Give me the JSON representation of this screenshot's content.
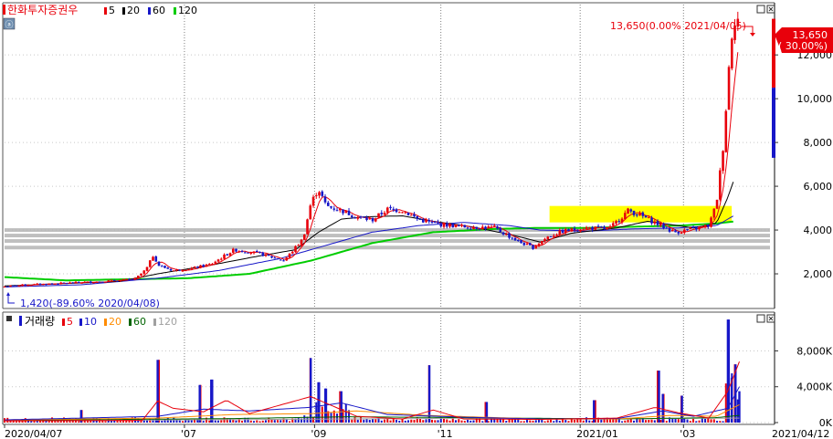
{
  "colors": {
    "up": "#e8000b",
    "down": "#1717c8",
    "ma5": "#e8000b",
    "ma20": "#000000",
    "ma60": "#1717c8",
    "ma120": "#00cc00",
    "highlight": "#ffff00",
    "hline": "#b4b4b4",
    "vol_ma10": "#1717c8",
    "vol_ma20": "#ff8c00",
    "vol_ma60": "#006400",
    "vol_ma120": "#a0a0a0",
    "grid": "#7f7f7f"
  },
  "price_legend": {
    "title": "한화투자증권우",
    "ma": [
      {
        "label": "5",
        "color": "#e8000b"
      },
      {
        "label": "20",
        "color": "#000000"
      },
      {
        "label": "60",
        "color": "#1717c8"
      },
      {
        "label": "120",
        "color": "#00cc00"
      }
    ]
  },
  "volume_legend": {
    "title": "거래량",
    "ma": [
      {
        "label": "5",
        "color": "#e8000b"
      },
      {
        "label": "10",
        "color": "#1717c8"
      },
      {
        "label": "20",
        "color": "#ff8c00"
      },
      {
        "label": "60",
        "color": "#006400"
      },
      {
        "label": "120",
        "color": "#a0a0a0"
      }
    ]
  },
  "annotations": {
    "high": "13,650(0.00% 2021/04/05)",
    "low": "1,420(-89.60% 2020/04/08)",
    "current_price": "13,650",
    "current_change": "( 30.00%)"
  },
  "side_button": "ⓐ",
  "x_axis": {
    "start_date": "2020/04/07",
    "end_date": "2021/04/12",
    "ticks": [
      "'07",
      "'09",
      "'11",
      "2021/01",
      "'03"
    ]
  },
  "chart_data": [
    {
      "type": "candlestick",
      "title": "한화투자증권우",
      "ylim": [
        500,
        14300
      ],
      "yticks": [
        "2,000",
        "4,000",
        "6,000",
        "8,000",
        "10,000",
        "12,000"
      ],
      "ytick_values": [
        2000,
        4000,
        6000,
        8000,
        10000,
        12000
      ],
      "horizontal_levels": [
        3200,
        3500,
        3750,
        4000
      ],
      "highlight_band": {
        "x_start": 0.712,
        "x_end": 0.95,
        "y_low": 4350,
        "y_high": 5100
      },
      "last": 13650,
      "last_change_pct": 30.0,
      "high": {
        "value": 13650,
        "date": "2021/04/05",
        "pct": 0.0
      },
      "low": {
        "value": 1420,
        "date": "2020/04/08",
        "pct": -89.6
      },
      "anchors": [
        [
          0.0,
          1420
        ],
        [
          0.03,
          1500
        ],
        [
          0.07,
          1560
        ],
        [
          0.12,
          1640
        ],
        [
          0.17,
          1750
        ],
        [
          0.185,
          2200
        ],
        [
          0.195,
          2900
        ],
        [
          0.2,
          2400
        ],
        [
          0.22,
          2150
        ],
        [
          0.245,
          2250
        ],
        [
          0.27,
          2450
        ],
        [
          0.3,
          3100
        ],
        [
          0.33,
          2950
        ],
        [
          0.365,
          2600
        ],
        [
          0.39,
          3600
        ],
        [
          0.4,
          5200
        ],
        [
          0.41,
          5900
        ],
        [
          0.42,
          5100
        ],
        [
          0.44,
          4900
        ],
        [
          0.46,
          4600
        ],
        [
          0.48,
          4450
        ],
        [
          0.5,
          4950
        ],
        [
          0.52,
          4900
        ],
        [
          0.54,
          4500
        ],
        [
          0.56,
          4300
        ],
        [
          0.6,
          4150
        ],
        [
          0.64,
          4100
        ],
        [
          0.67,
          3500
        ],
        [
          0.69,
          3200
        ],
        [
          0.71,
          3700
        ],
        [
          0.73,
          3950
        ],
        [
          0.76,
          4100
        ],
        [
          0.79,
          4050
        ],
        [
          0.815,
          4900
        ],
        [
          0.835,
          4600
        ],
        [
          0.855,
          4250
        ],
        [
          0.875,
          3900
        ],
        [
          0.9,
          4050
        ],
        [
          0.92,
          4200
        ],
        [
          0.93,
          5200
        ],
        [
          0.94,
          8200
        ],
        [
          0.945,
          10900
        ],
        [
          0.952,
          13650
        ],
        [
          0.958,
          13650
        ]
      ],
      "ma20_anchors": [
        [
          0.0,
          1450
        ],
        [
          0.15,
          1650
        ],
        [
          0.2,
          2000
        ],
        [
          0.27,
          2400
        ],
        [
          0.33,
          2800
        ],
        [
          0.38,
          3100
        ],
        [
          0.41,
          3900
        ],
        [
          0.44,
          4500
        ],
        [
          0.47,
          4600
        ],
        [
          0.52,
          4650
        ],
        [
          0.56,
          4400
        ],
        [
          0.61,
          4150
        ],
        [
          0.66,
          3800
        ],
        [
          0.7,
          3450
        ],
        [
          0.74,
          3850
        ],
        [
          0.8,
          4100
        ],
        [
          0.84,
          4400
        ],
        [
          0.9,
          4100
        ],
        [
          0.93,
          4300
        ],
        [
          0.945,
          5500
        ],
        [
          0.955,
          6500
        ]
      ],
      "ma60_anchors": [
        [
          0.0,
          1400
        ],
        [
          0.1,
          1500
        ],
        [
          0.2,
          1800
        ],
        [
          0.28,
          2150
        ],
        [
          0.36,
          2700
        ],
        [
          0.42,
          3300
        ],
        [
          0.48,
          3900
        ],
        [
          0.54,
          4200
        ],
        [
          0.6,
          4350
        ],
        [
          0.66,
          4200
        ],
        [
          0.7,
          4000
        ],
        [
          0.76,
          3950
        ],
        [
          0.82,
          4050
        ],
        [
          0.88,
          4100
        ],
        [
          0.93,
          4200
        ],
        [
          0.955,
          4700
        ]
      ],
      "ma120_anchors": [
        [
          0.0,
          1850
        ],
        [
          0.08,
          1700
        ],
        [
          0.16,
          1750
        ],
        [
          0.24,
          1800
        ],
        [
          0.32,
          2000
        ],
        [
          0.4,
          2600
        ],
        [
          0.48,
          3400
        ],
        [
          0.56,
          3900
        ],
        [
          0.64,
          4050
        ],
        [
          0.7,
          4100
        ],
        [
          0.76,
          4100
        ],
        [
          0.82,
          4150
        ],
        [
          0.88,
          4200
        ],
        [
          0.93,
          4300
        ],
        [
          0.955,
          4400
        ]
      ]
    },
    {
      "type": "bar",
      "title": "거래량",
      "ylim": [
        0,
        11000
      ],
      "yticks": [
        "0K",
        "4,000K",
        "8,000K"
      ],
      "ytick_values": [
        0,
        4000,
        8000
      ],
      "spikes": [
        [
          0.1,
          1400
        ],
        [
          0.2,
          7000
        ],
        [
          0.255,
          4200
        ],
        [
          0.27,
          4800
        ],
        [
          0.4,
          7200
        ],
        [
          0.41,
          4500
        ],
        [
          0.42,
          3800
        ],
        [
          0.44,
          3500
        ],
        [
          0.555,
          6400
        ],
        [
          0.63,
          2300
        ],
        [
          0.77,
          2500
        ],
        [
          0.855,
          5800
        ],
        [
          0.86,
          3200
        ],
        [
          0.885,
          3000
        ],
        [
          0.945,
          11500
        ],
        [
          0.95,
          5000
        ],
        [
          0.955,
          6500
        ],
        [
          0.96,
          3500
        ]
      ],
      "ma5_anchors": [
        [
          0.0,
          200
        ],
        [
          0.18,
          250
        ],
        [
          0.2,
          2400
        ],
        [
          0.22,
          1600
        ],
        [
          0.26,
          1200
        ],
        [
          0.29,
          2500
        ],
        [
          0.32,
          1000
        ],
        [
          0.4,
          2900
        ],
        [
          0.43,
          1800
        ],
        [
          0.46,
          700
        ],
        [
          0.52,
          400
        ],
        [
          0.56,
          1400
        ],
        [
          0.6,
          400
        ],
        [
          0.7,
          350
        ],
        [
          0.8,
          500
        ],
        [
          0.85,
          1700
        ],
        [
          0.88,
          1100
        ],
        [
          0.92,
          500
        ],
        [
          0.945,
          3500
        ],
        [
          0.96,
          6800
        ]
      ],
      "ma10_anchors": [
        [
          0.0,
          300
        ],
        [
          0.2,
          700
        ],
        [
          0.26,
          1500
        ],
        [
          0.32,
          1300
        ],
        [
          0.4,
          1700
        ],
        [
          0.44,
          2200
        ],
        [
          0.5,
          900
        ],
        [
          0.6,
          600
        ],
        [
          0.7,
          400
        ],
        [
          0.8,
          450
        ],
        [
          0.86,
          1300
        ],
        [
          0.9,
          700
        ],
        [
          0.945,
          1600
        ],
        [
          0.96,
          4000
        ]
      ],
      "ma20_anchors": [
        [
          0.0,
          300
        ],
        [
          0.2,
          500
        ],
        [
          0.3,
          900
        ],
        [
          0.4,
          1000
        ],
        [
          0.46,
          1300
        ],
        [
          0.55,
          800
        ],
        [
          0.7,
          400
        ],
        [
          0.8,
          400
        ],
        [
          0.87,
          800
        ],
        [
          0.93,
          700
        ],
        [
          0.96,
          2000
        ]
      ],
      "ma60_anchors": [
        [
          0.0,
          250
        ],
        [
          0.3,
          450
        ],
        [
          0.45,
          650
        ],
        [
          0.6,
          550
        ],
        [
          0.8,
          400
        ],
        [
          0.93,
          550
        ],
        [
          0.96,
          800
        ]
      ],
      "ma120_anchors": [
        [
          0.0,
          200
        ],
        [
          0.4,
          380
        ],
        [
          0.6,
          480
        ],
        [
          0.8,
          420
        ],
        [
          0.96,
          500
        ]
      ]
    }
  ]
}
